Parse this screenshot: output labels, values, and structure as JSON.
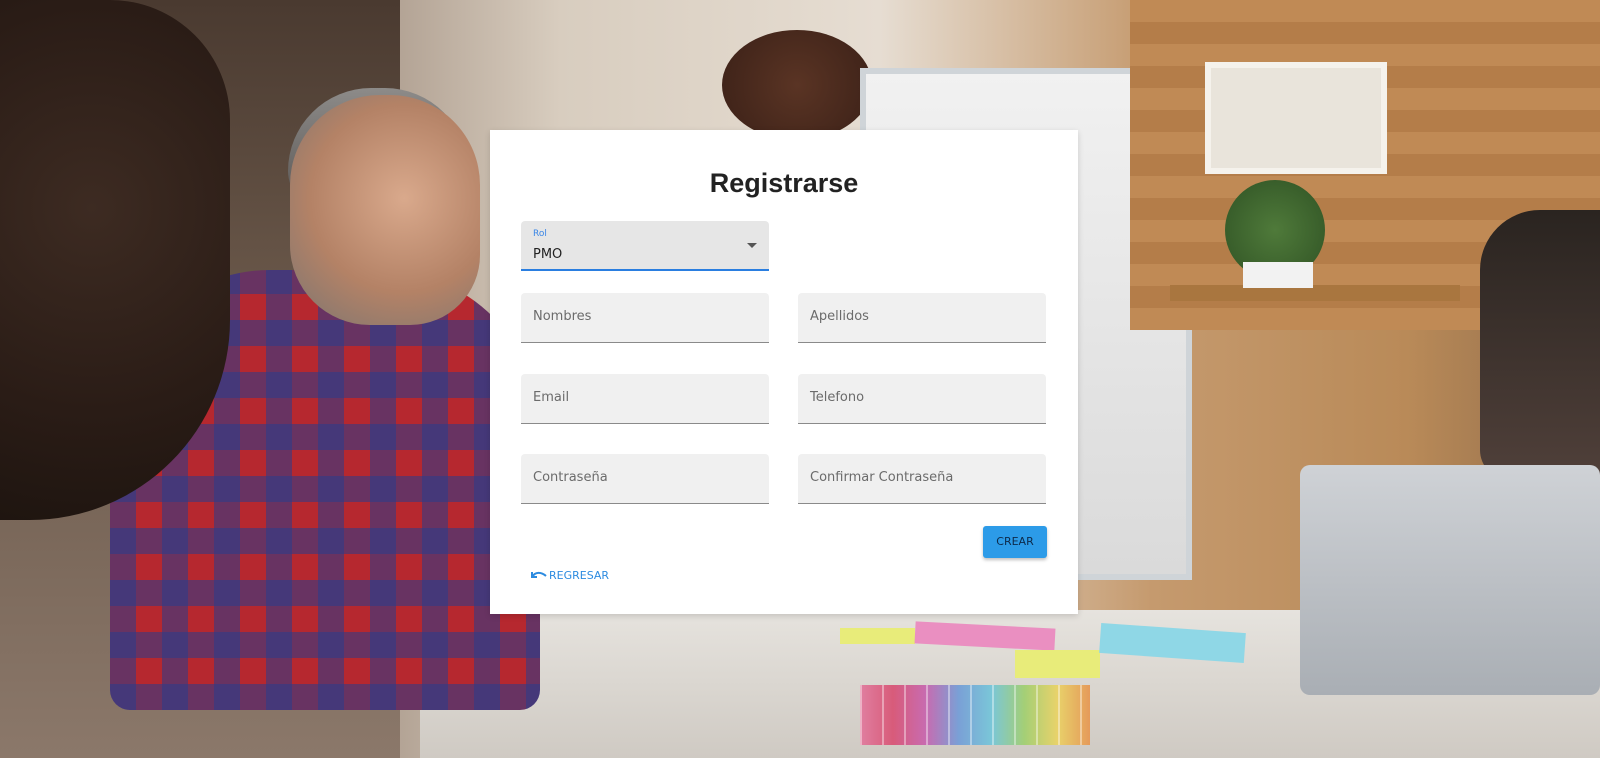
{
  "form": {
    "title": "Registrarse",
    "role": {
      "label": "Rol",
      "value": "PMO"
    },
    "fields": {
      "nombres": "Nombres",
      "apellidos": "Apellidos",
      "email": "Email",
      "telefono": "Telefono",
      "contrasena": "Contraseña",
      "confirmar_contrasena": "Confirmar Contraseña"
    },
    "actions": {
      "create_label": "CREAR",
      "back_label": "REGRESAR"
    }
  },
  "colors": {
    "accent": "#2c9be8",
    "link": "#2c8be0",
    "field_bg": "#f0f0f0"
  },
  "icons": {
    "back": "undo-arrow-icon",
    "select": "caret-down-icon"
  }
}
